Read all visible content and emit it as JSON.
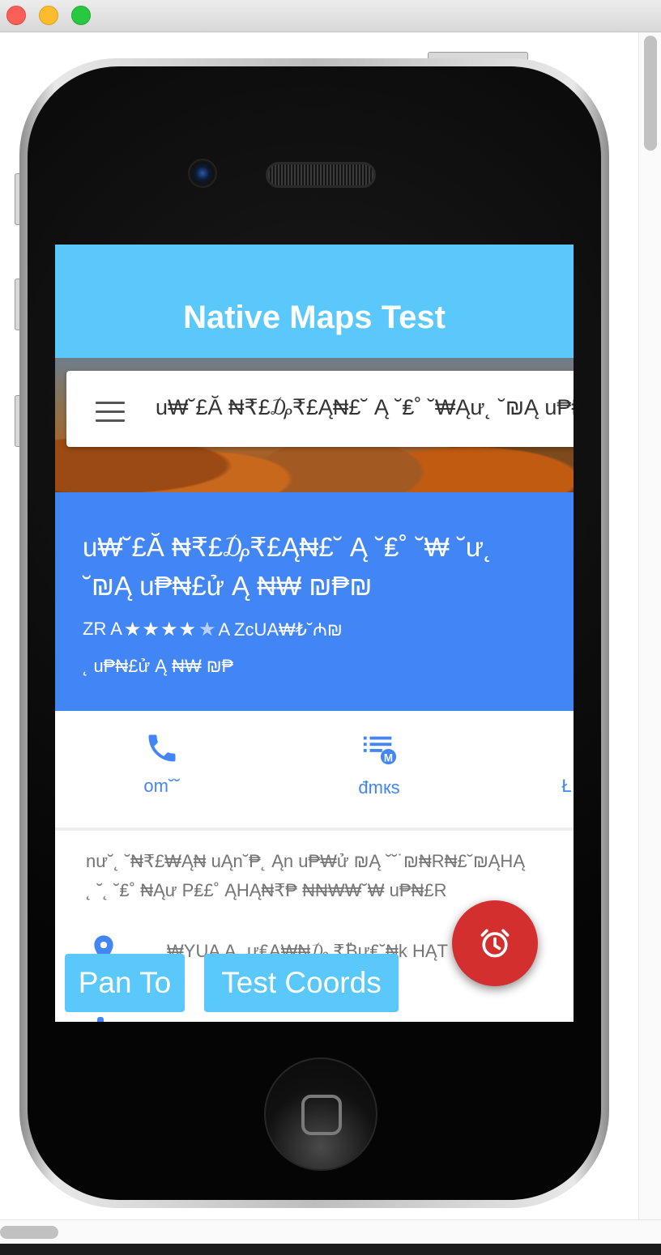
{
  "app": {
    "title": "Native Maps Test"
  },
  "search": {
    "query": "u₩˘£Ă ₦₹£₯₹£Ą₦£˘ Ą ˘₤˚ ˘₩Ąư˛ ˘₪Ą u₱₦£ử Ą ₦₩ ₪₱₪"
  },
  "place": {
    "name": "u₩˘£Ă ₦₹£₯₹£Ą₦£˘ Ą ˘₤˚ ˘₩ ˘ư˛ ˘₪Ą u₱₦£ử Ą ₦₩ ₪₱₪",
    "rating_prefix": "ZR A",
    "rating_value": 4.5,
    "stars": "★★★★",
    "star_half": "★",
    "rating_suffix": "A ZcUA₩₺˘₼₪",
    "subtitle": "˛ u₱₦£ử Ą ₦₩ ₪₱"
  },
  "actions": [
    {
      "label": "om˘˘",
      "icon": "phone-icon"
    },
    {
      "label": "đmкs",
      "icon": "playlist-icon"
    },
    {
      "label": "Ł s",
      "icon": "share-icon"
    }
  ],
  "details": {
    "description_line1": "nư˘˛ ˘₦₹£₩Ą₦ uĄn˘₱˛ Ąn u₱₩ử ₪Ą ˘˘˙₪₦R₦£˘₪ĄHĄ",
    "description_line2": "˛ ˘˛ ˘₤˚ ₦Ąư  P₤£˚ ĄHĄ₦₹₱ ₦₦₩₩˘₩ u₱₦£R",
    "address": "₩YUA Ą ˛ư₤Ą₩₦₯ ₹₿ư₤˘₦k HĄT"
  },
  "buttons": {
    "pan_to": "Pan To",
    "test_coords": "Test Coords"
  },
  "fab": {
    "icon": "alarm-icon"
  },
  "colors": {
    "appbar": "#5ac8fa",
    "place_card": "#4285f4",
    "action": "#4285f4",
    "fab": "#d32f2f"
  }
}
